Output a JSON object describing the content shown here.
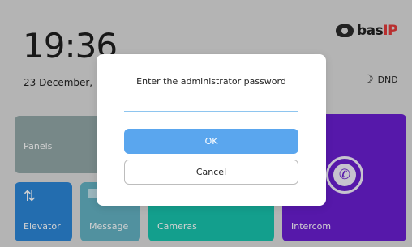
{
  "status": {
    "time": "19:36",
    "date": "23 December,",
    "dnd_label": "DND",
    "dnd_icon": "moon-icon"
  },
  "brand": {
    "name_main": "bas",
    "name_accent": "IP",
    "accent_color": "#e23b3b"
  },
  "tiles": {
    "panels": {
      "label": "Panels",
      "color": "#92a6a7"
    },
    "elevator": {
      "label": "Elevator",
      "color": "#2b86d6",
      "icon": "elevator-icon"
    },
    "message": {
      "label": "Message",
      "color": "#63b1c3",
      "icon": "message-icon"
    },
    "cameras": {
      "label": "Cameras",
      "color": "#18c3ad"
    },
    "intercom": {
      "label": "Intercom",
      "color": "#6a1ed0",
      "icon": "phone-icon"
    }
  },
  "dialog": {
    "title": "Enter the administrator password",
    "password_value": "",
    "ok_label": "OK",
    "cancel_label": "Cancel",
    "ok_color": "#5aa6ee"
  }
}
